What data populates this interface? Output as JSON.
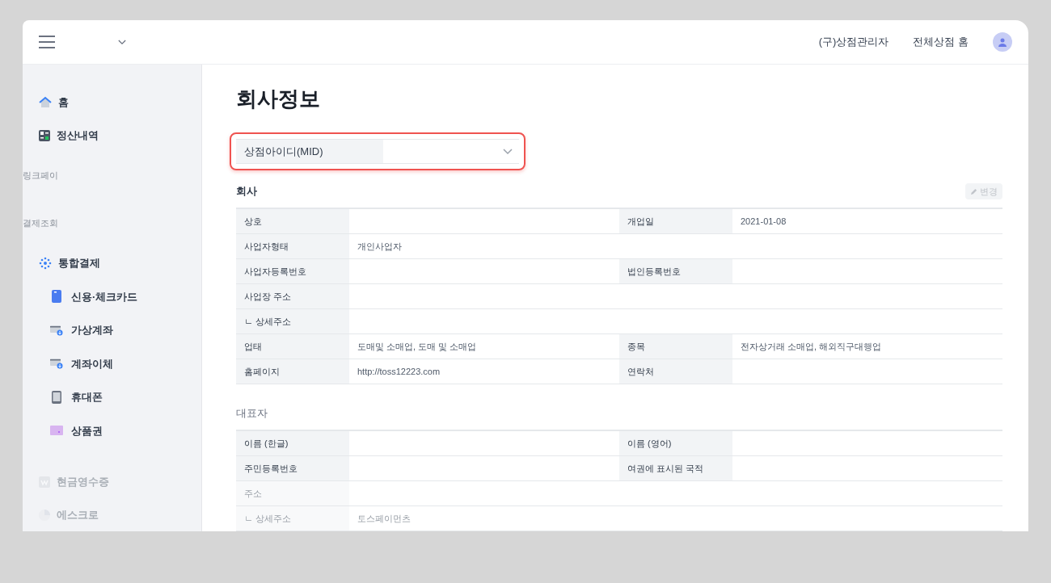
{
  "header": {
    "links": [
      "(구)상점관리자",
      "전체상점 홈"
    ]
  },
  "sidebar": {
    "items": [
      {
        "kind": "item",
        "label": "홈",
        "faded": false
      },
      {
        "kind": "item",
        "label": "정산내역",
        "faded": false
      },
      {
        "kind": "section",
        "label": "링크페이"
      },
      {
        "kind": "section",
        "label": "결제조회"
      },
      {
        "kind": "item",
        "label": "통합결제",
        "faded": false,
        "children": [
          {
            "label": "신용·체크카드"
          },
          {
            "label": "가상계좌"
          },
          {
            "label": "계좌이체"
          },
          {
            "label": "휴대폰"
          },
          {
            "label": "상품권"
          }
        ]
      },
      {
        "kind": "item",
        "label": "현금영수증",
        "faded": true
      },
      {
        "kind": "item",
        "label": "에스크로",
        "faded": true
      }
    ]
  },
  "page": {
    "title": "회사정보",
    "mid": {
      "label": "상점아이디(MID)",
      "highlighted": true
    },
    "sections": [
      {
        "title": "회사",
        "edit_button": "변경",
        "rows": [
          {
            "faded": false,
            "cells": [
              {
                "label": "상호"
              },
              {
                "label": "개업일",
                "value": "2021-01-08"
              }
            ]
          },
          {
            "faded": false,
            "cells": [
              {
                "label": "사업자형태",
                "value": "개인사업자"
              }
            ]
          },
          {
            "faded": false,
            "cells": [
              {
                "label": "사업자등록번호"
              },
              {
                "label": "법인등록번호"
              }
            ]
          },
          {
            "faded": false,
            "cells": [
              {
                "label": "사업장 주소"
              }
            ]
          },
          {
            "faded": false,
            "cells": [
              {
                "label": "ㄴ 상세주소"
              }
            ]
          },
          {
            "faded": false,
            "cells": [
              {
                "label": "업태",
                "value": "도매및 소매업, 도매 및 소매업"
              },
              {
                "label": "종목",
                "value": "전자상거래 소매업, 해외직구대행업"
              }
            ]
          },
          {
            "faded": false,
            "cells": [
              {
                "label": "홈페이지",
                "value": "http://toss12223.com"
              },
              {
                "label": "연락처"
              }
            ]
          }
        ]
      },
      {
        "title": "대표자",
        "rows": [
          {
            "faded": false,
            "cells": [
              {
                "label": "이름 (한글)"
              },
              {
                "label": "이름 (영어)"
              }
            ]
          },
          {
            "faded": false,
            "cells": [
              {
                "label": "주민등록번호"
              },
              {
                "label": "여권에 표시된 국적"
              }
            ]
          },
          {
            "faded": true,
            "cells": [
              {
                "label": "주소"
              }
            ]
          },
          {
            "faded": true,
            "cells": [
              {
                "label": "ㄴ 상세주소",
                "value": "토스페이먼츠"
              }
            ]
          }
        ]
      }
    ]
  }
}
